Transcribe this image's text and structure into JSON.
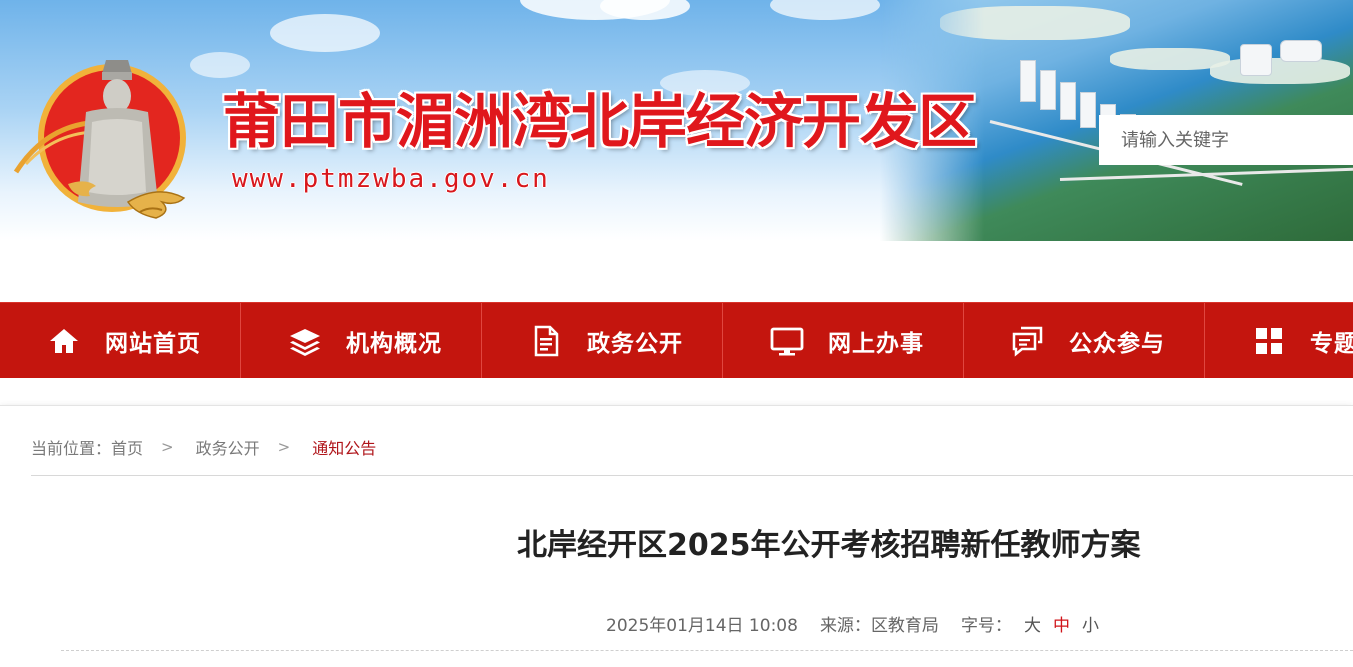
{
  "header": {
    "site_title": "莆田市湄洲湾北岸经济开发区",
    "site_url": "www.ptmzwba.gov.cn",
    "logo_icon": "mazu-statue-logo-icon",
    "search": {
      "placeholder": "请输入关键字",
      "value": ""
    }
  },
  "nav": {
    "items": [
      {
        "label": "网站首页",
        "icon": "home-icon"
      },
      {
        "label": "机构概况",
        "icon": "layers-icon"
      },
      {
        "label": "政务公开",
        "icon": "document-icon"
      },
      {
        "label": "网上办事",
        "icon": "monitor-icon"
      },
      {
        "label": "公众参与",
        "icon": "chat-icon"
      },
      {
        "label": "专题",
        "icon": "grid-icon"
      }
    ],
    "background": "#c4150e"
  },
  "breadcrumb": {
    "prefix": "当前位置：",
    "items": [
      "首页",
      "政务公开",
      "通知公告"
    ],
    "separator": ">"
  },
  "article": {
    "title": "北岸经开区2025年公开考核招聘新任教师方案",
    "datetime": "2025年01月14日 10:08",
    "source_label": "来源：",
    "source": "区教育局",
    "font_size_label": "字号：",
    "font_sizes": [
      "大",
      "中",
      "小"
    ],
    "active_font_size": "中"
  },
  "colors": {
    "accent_red": "#e0171c",
    "nav_red": "#c4150e",
    "current_crumb": "#b0161b"
  }
}
